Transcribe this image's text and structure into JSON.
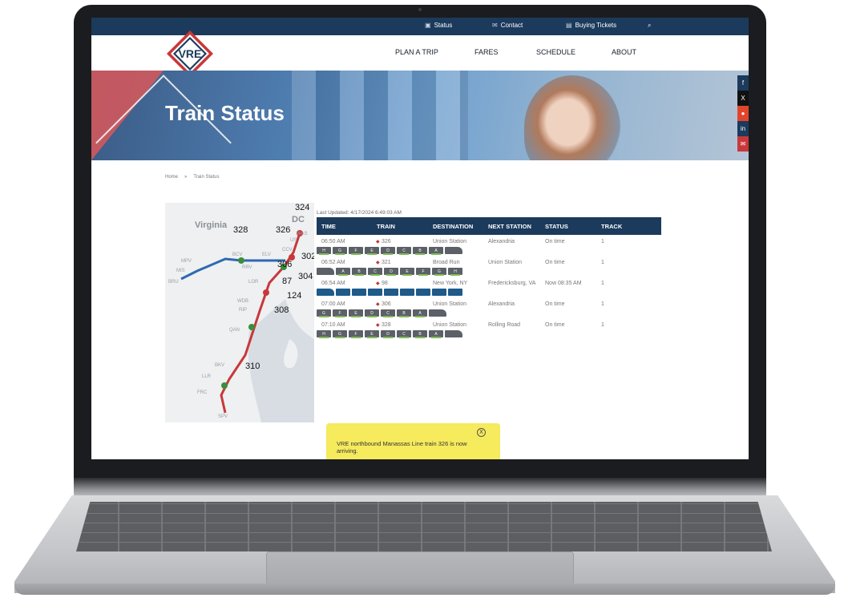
{
  "topbar": {
    "items": [
      {
        "icon": "status-icon",
        "label": "Status"
      },
      {
        "icon": "contact-icon",
        "label": "Contact"
      },
      {
        "icon": "ticket-icon",
        "label": "Buying Tickets"
      }
    ],
    "search_icon": "search-icon"
  },
  "logo": {
    "text": "VRE"
  },
  "nav": {
    "items": [
      "PLAN A TRIP",
      "FARES",
      "SCHEDULE",
      "ABOUT"
    ]
  },
  "hero": {
    "title": "Train Status"
  },
  "share": [
    {
      "icon": "facebook-icon",
      "glyph": "f",
      "color": "#1b3a5c"
    },
    {
      "icon": "x-icon",
      "glyph": "𝕏",
      "color": "#111111"
    },
    {
      "icon": "reddit-icon",
      "glyph": "●",
      "color": "#e2452b"
    },
    {
      "icon": "linkedin-icon",
      "glyph": "in",
      "color": "#1b3a5c"
    },
    {
      "icon": "mail-icon",
      "glyph": "✉",
      "color": "#c8383a"
    }
  ],
  "breadcrumb": {
    "home": "Home",
    "sep": "»",
    "current": "Train Status"
  },
  "map": {
    "state_label": "Virginia",
    "dc_label": "DC",
    "train_numbers": [
      "324",
      "328",
      "326",
      "302",
      "306",
      "304",
      "87",
      "124",
      "308",
      "310"
    ],
    "stations": [
      "BRU",
      "MIS",
      "MPV",
      "BCV",
      "RRV",
      "LOR",
      "ELV",
      "CCV",
      "WDB",
      "RIP",
      "QAN",
      "BKV",
      "LLR",
      "FRC",
      "SPV",
      "US",
      "WAS"
    ]
  },
  "status": {
    "last_updated": "Last Updated: 4/17/2024 6:49:03 AM",
    "columns": [
      "TIME",
      "TRAIN",
      "DESTINATION",
      "NEXT STATION",
      "STATUS",
      "TRACK"
    ],
    "rows": [
      {
        "time": "06:50 AM",
        "train": "326",
        "destination": "Union Station",
        "next": "Alexandria",
        "status": "On time",
        "track": "1",
        "cars": [
          "H",
          "G",
          "F",
          "E",
          "D",
          "C",
          "B",
          "A"
        ],
        "blue": false,
        "loco_first": false
      },
      {
        "time": "06:52 AM",
        "train": "321",
        "destination": "Broad Run",
        "next": "Union Station",
        "status": "On time",
        "track": "1",
        "cars": [
          "A",
          "B",
          "C",
          "D",
          "E",
          "F",
          "G",
          "H"
        ],
        "blue": false,
        "loco_first": true
      },
      {
        "time": "06:54 AM",
        "train": "98",
        "destination": "New York, NY",
        "next": "Fredericksburg, VA",
        "status": "Now 08:35 AM",
        "track": "1",
        "cars": [
          "",
          "",
          "",
          "",
          "",
          "",
          "",
          ""
        ],
        "blue": true,
        "loco_first": true
      },
      {
        "time": "07:00 AM",
        "train": "306",
        "destination": "Union Station",
        "next": "Alexandria",
        "status": "On time",
        "track": "1",
        "cars": [
          "G",
          "F",
          "E",
          "D",
          "C",
          "B",
          "A"
        ],
        "blue": false,
        "loco_first": false
      },
      {
        "time": "07:10 AM",
        "train": "328",
        "destination": "Union Station",
        "next": "Rolling Road",
        "status": "On time",
        "track": "1",
        "cars": [
          "H",
          "G",
          "F",
          "E",
          "D",
          "C",
          "B",
          "A"
        ],
        "blue": false,
        "loco_first": false
      }
    ]
  },
  "toast": {
    "message": "VRE northbound Manassas Line train 326 is now arriving.",
    "close": "X"
  }
}
